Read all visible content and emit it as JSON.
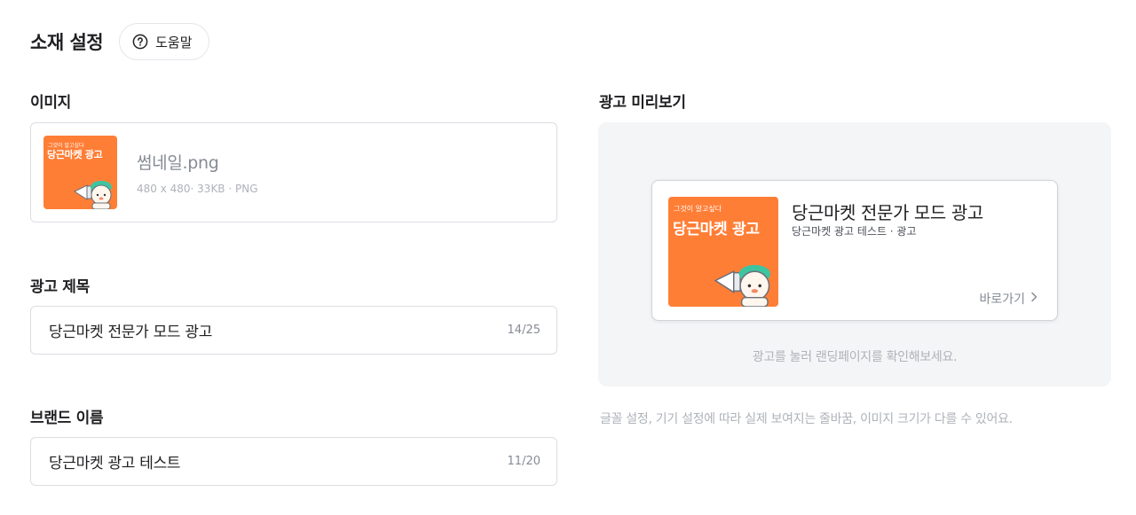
{
  "header": {
    "title": "소재 설정",
    "help_label": "도움말"
  },
  "image_section": {
    "label": "이미지",
    "thumbnail": {
      "sub_text": "그것이 알고싶다",
      "main_text": "당근마켓 광고"
    },
    "file_name": "썸네일.png",
    "file_meta": "480 x 480· 33KB · PNG"
  },
  "ad_title_field": {
    "label": "광고 제목",
    "value": "당근마켓 전문가 모드 광고",
    "count": "14/25"
  },
  "brand_field": {
    "label": "브랜드 이름",
    "value": "당근마켓 광고 테스트",
    "count": "11/20"
  },
  "preview": {
    "label": "광고 미리보기",
    "card": {
      "thumb_sub": "그것이 알고싶다",
      "thumb_main": "당근마켓 광고",
      "title": "당근마켓 전문가 모드 광고",
      "brand": "당근마켓 광고 테스트 · 광고",
      "link_label": "바로가기"
    },
    "hint": "광고를 눌러 랜딩페이지를 확인해보세요."
  },
  "footnote": "글꼴 설정, 기기 설정에 따라 실제 보여지는 줄바꿈, 이미지 크기가 다를 수 있어요.",
  "colors": {
    "brand_orange": "#ff7e36",
    "panel_bg": "#f4f5f7",
    "border": "#dcdee3"
  },
  "icons": [
    "help-circle-icon",
    "chevron-right-icon",
    "megaphone-character-icon"
  ]
}
